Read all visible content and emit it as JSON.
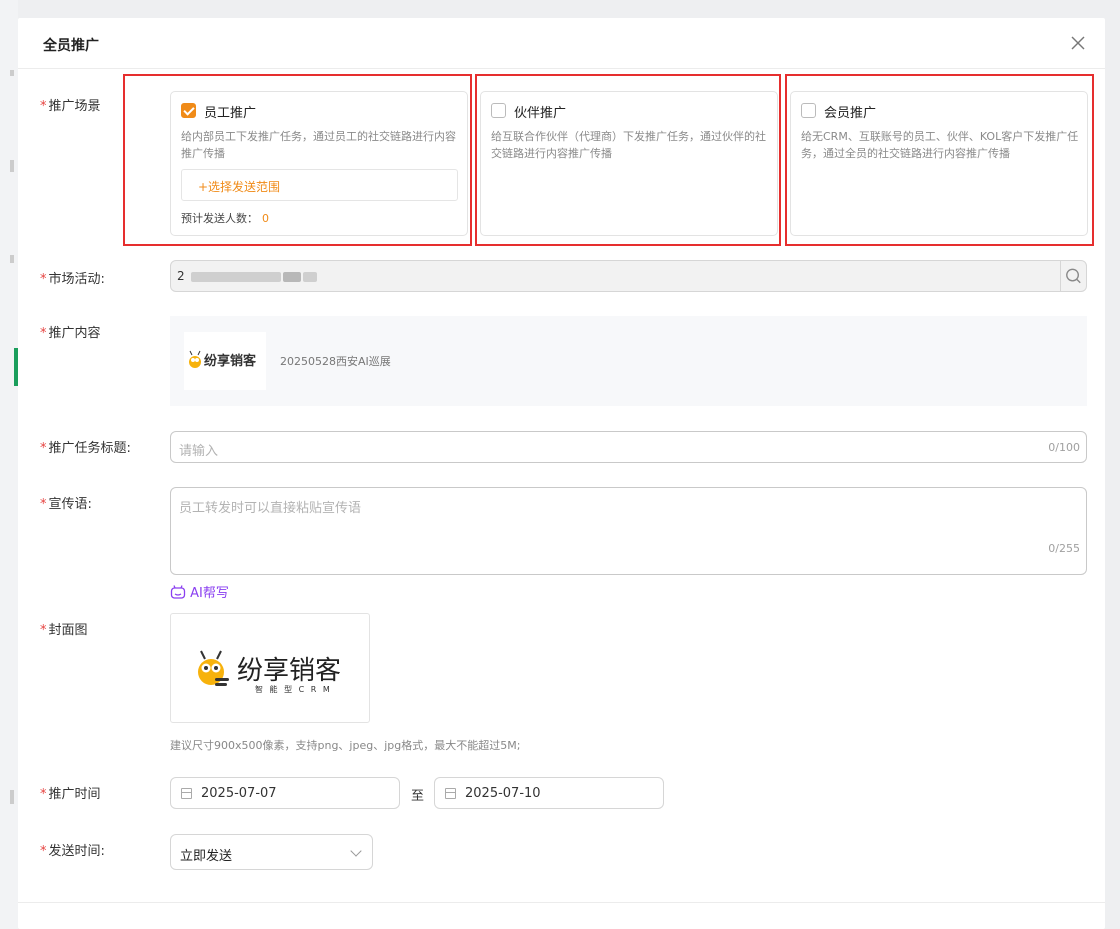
{
  "dialog": {
    "title": "全员推广"
  },
  "labels": {
    "scene": "推广场景",
    "market": "市场活动:",
    "content": "推广内容",
    "task_title": "推广任务标题:",
    "slogan": "宣传语:",
    "cover": "封面图",
    "period": "推广时间",
    "send_time": "发送时间:"
  },
  "required_mark": "*",
  "scenes": [
    {
      "title": "员工推广",
      "checked": true,
      "desc": "给内部员工下发推广任务，通过员工的社交链路进行内容推广传播",
      "range_button": "+选择发送范围",
      "estimate_label": "预计发送人数：",
      "estimate_count": "0"
    },
    {
      "title": "伙伴推广",
      "checked": false,
      "desc": "给互联合作伙伴（代理商）下发推广任务，通过伙伴的社交链路进行内容推广传播"
    },
    {
      "title": "会员推广",
      "checked": false,
      "desc": "给无CRM、互联账号的员工、伙伴、KOL客户下发推广任务，通过全员的社交链路进行内容推广传播"
    }
  ],
  "market": {
    "value_prefix": "2"
  },
  "content": {
    "logo_text": "纷享销客",
    "name": "20250528西安AI巡展"
  },
  "task_title": {
    "placeholder": "请输入",
    "counter": "0/100"
  },
  "slogan": {
    "placeholder": "员工转发时可以直接粘贴宣传语",
    "counter": "0/255"
  },
  "ai_write": {
    "label": "AI帮写"
  },
  "cover": {
    "brand_name": "纷享销客",
    "brand_sub": "智 能 型 C R M",
    "hint": "建议尺寸900x500像素，支持png、jpeg、jpg格式，最大不能超过5M;"
  },
  "period": {
    "start": "2025-07-07",
    "separator": "至",
    "end": "2025-07-10"
  },
  "send_time": {
    "value": "立即发送"
  },
  "colors": {
    "accent_orange": "#f08b18",
    "required_red": "#e64340",
    "highlight_red": "#e62e2e",
    "ai_purple": "#8a3ff0"
  }
}
